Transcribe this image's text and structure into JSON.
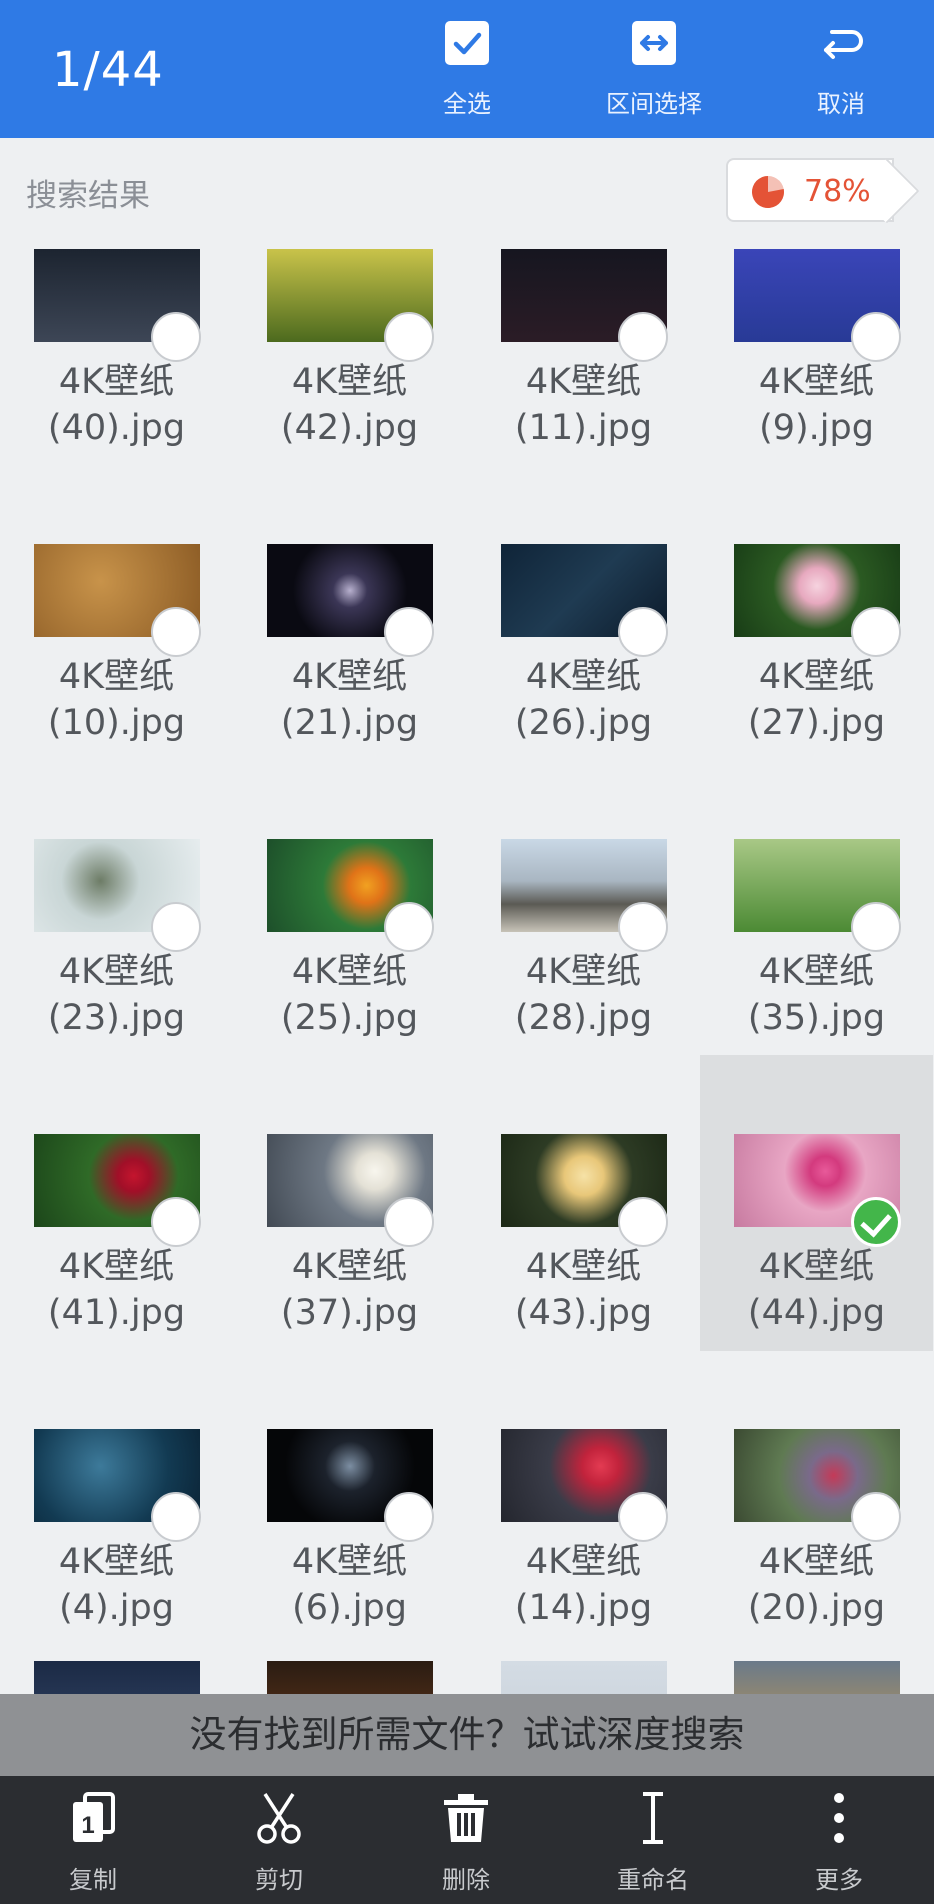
{
  "header": {
    "selection_count": "1/44",
    "actions": [
      {
        "label": "全选",
        "icon": "select-all-checkbox-icon"
      },
      {
        "label": "区间选择",
        "icon": "range-select-icon"
      },
      {
        "label": "取消",
        "icon": "cancel-return-icon"
      }
    ],
    "background_color": "#2f7ae5"
  },
  "section": {
    "title": "搜索结果",
    "storage_percent": "78%",
    "storage_fraction": 0.78,
    "storage_color": "#e45336"
  },
  "files": [
    {
      "name_line1": "4K壁纸",
      "name_line2": "(40).jpg",
      "selected": false
    },
    {
      "name_line1": "4K壁纸",
      "name_line2": "(42).jpg",
      "selected": false
    },
    {
      "name_line1": "4K壁纸",
      "name_line2": "(11).jpg",
      "selected": false
    },
    {
      "name_line1": "4K壁纸",
      "name_line2": "(9).jpg",
      "selected": false
    },
    {
      "name_line1": "4K壁纸",
      "name_line2": "(10).jpg",
      "selected": false
    },
    {
      "name_line1": "4K壁纸",
      "name_line2": "(21).jpg",
      "selected": false
    },
    {
      "name_line1": "4K壁纸",
      "name_line2": "(26).jpg",
      "selected": false
    },
    {
      "name_line1": "4K壁纸",
      "name_line2": "(27).jpg",
      "selected": false
    },
    {
      "name_line1": "4K壁纸",
      "name_line2": "(23).jpg",
      "selected": false
    },
    {
      "name_line1": "4K壁纸",
      "name_line2": "(25).jpg",
      "selected": false
    },
    {
      "name_line1": "4K壁纸",
      "name_line2": "(28).jpg",
      "selected": false
    },
    {
      "name_line1": "4K壁纸",
      "name_line2": "(35).jpg",
      "selected": false
    },
    {
      "name_line1": "4K壁纸",
      "name_line2": "(41).jpg",
      "selected": false
    },
    {
      "name_line1": "4K壁纸",
      "name_line2": "(37).jpg",
      "selected": false
    },
    {
      "name_line1": "4K壁纸",
      "name_line2": "(43).jpg",
      "selected": false
    },
    {
      "name_line1": "4K壁纸",
      "name_line2": "(44).jpg",
      "selected": true
    },
    {
      "name_line1": "4K壁纸",
      "name_line2": "(4).jpg",
      "selected": false
    },
    {
      "name_line1": "4K壁纸",
      "name_line2": "(6).jpg",
      "selected": false
    },
    {
      "name_line1": "4K壁纸",
      "name_line2": "(14).jpg",
      "selected": false
    },
    {
      "name_line1": "4K壁纸",
      "name_line2": "(20).jpg",
      "selected": false
    }
  ],
  "deep_search_text": "没有找到所需文件？试试深度搜索",
  "toolbar": [
    {
      "label": "复制",
      "icon": "copy-icon"
    },
    {
      "label": "剪切",
      "icon": "scissors-icon"
    },
    {
      "label": "删除",
      "icon": "trash-icon"
    },
    {
      "label": "重命名",
      "icon": "text-cursor-icon"
    },
    {
      "label": "更多",
      "icon": "more-vertical-icon"
    }
  ]
}
